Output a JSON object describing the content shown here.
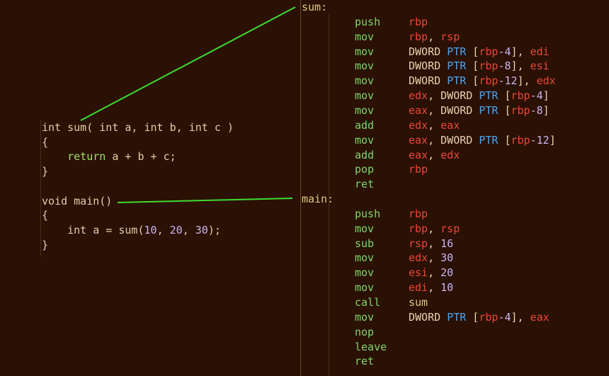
{
  "c_source": {
    "lines": [
      {
        "tokens": [
          {
            "t": "int sum( int a, int b, int c )",
            "c": "kw"
          }
        ]
      },
      {
        "tokens": [
          {
            "t": "{",
            "c": "plain"
          }
        ]
      },
      {
        "tokens": [
          {
            "t": "    ",
            "c": "plain"
          },
          {
            "t": "return",
            "c": "ret"
          },
          {
            "t": " a + b + c;",
            "c": "plain"
          }
        ]
      },
      {
        "tokens": [
          {
            "t": "}",
            "c": "plain"
          }
        ]
      },
      {
        "tokens": []
      },
      {
        "tokens": [
          {
            "t": "void main()",
            "c": "kw"
          }
        ]
      },
      {
        "tokens": [
          {
            "t": "{",
            "c": "plain"
          }
        ]
      },
      {
        "tokens": [
          {
            "t": "    int a = sum(",
            "c": "plain"
          },
          {
            "t": "10",
            "c": "num"
          },
          {
            "t": ", ",
            "c": "plain"
          },
          {
            "t": "20",
            "c": "num"
          },
          {
            "t": ", ",
            "c": "plain"
          },
          {
            "t": "30",
            "c": "num"
          },
          {
            "t": ");",
            "c": "plain"
          }
        ]
      },
      {
        "tokens": [
          {
            "t": "}",
            "c": "plain"
          }
        ]
      }
    ]
  },
  "asm": {
    "functions": [
      {
        "label": "sum:",
        "instructions": [
          {
            "mn": "push",
            "ops": [
              {
                "t": "rbp",
                "c": "reg"
              }
            ]
          },
          {
            "mn": "mov",
            "ops": [
              {
                "t": "rbp",
                "c": "reg"
              },
              {
                "t": ", ",
                "c": "sym"
              },
              {
                "t": "rsp",
                "c": "reg"
              }
            ]
          },
          {
            "mn": "mov",
            "ops": [
              {
                "t": "DWORD ",
                "c": "dw"
              },
              {
                "t": "PTR",
                "c": "ptr"
              },
              {
                "t": " [",
                "c": "sym"
              },
              {
                "t": "rbp",
                "c": "reg"
              },
              {
                "t": "-4",
                "c": "num"
              },
              {
                "t": "], ",
                "c": "sym"
              },
              {
                "t": "edi",
                "c": "reg"
              }
            ]
          },
          {
            "mn": "mov",
            "ops": [
              {
                "t": "DWORD ",
                "c": "dw"
              },
              {
                "t": "PTR",
                "c": "ptr"
              },
              {
                "t": " [",
                "c": "sym"
              },
              {
                "t": "rbp",
                "c": "reg"
              },
              {
                "t": "-8",
                "c": "num"
              },
              {
                "t": "], ",
                "c": "sym"
              },
              {
                "t": "esi",
                "c": "reg"
              }
            ]
          },
          {
            "mn": "mov",
            "ops": [
              {
                "t": "DWORD ",
                "c": "dw"
              },
              {
                "t": "PTR",
                "c": "ptr"
              },
              {
                "t": " [",
                "c": "sym"
              },
              {
                "t": "rbp",
                "c": "reg"
              },
              {
                "t": "-12",
                "c": "num"
              },
              {
                "t": "], ",
                "c": "sym"
              },
              {
                "t": "edx",
                "c": "reg"
              }
            ]
          },
          {
            "mn": "mov",
            "ops": [
              {
                "t": "edx",
                "c": "reg"
              },
              {
                "t": ", DWORD ",
                "c": "dw"
              },
              {
                "t": "PTR",
                "c": "ptr"
              },
              {
                "t": " [",
                "c": "sym"
              },
              {
                "t": "rbp",
                "c": "reg"
              },
              {
                "t": "-4",
                "c": "num"
              },
              {
                "t": "]",
                "c": "sym"
              }
            ]
          },
          {
            "mn": "mov",
            "ops": [
              {
                "t": "eax",
                "c": "reg"
              },
              {
                "t": ", DWORD ",
                "c": "dw"
              },
              {
                "t": "PTR",
                "c": "ptr"
              },
              {
                "t": " [",
                "c": "sym"
              },
              {
                "t": "rbp",
                "c": "reg"
              },
              {
                "t": "-8",
                "c": "num"
              },
              {
                "t": "]",
                "c": "sym"
              }
            ]
          },
          {
            "mn": "add",
            "ops": [
              {
                "t": "edx",
                "c": "reg"
              },
              {
                "t": ", ",
                "c": "sym"
              },
              {
                "t": "eax",
                "c": "reg"
              }
            ]
          },
          {
            "mn": "mov",
            "ops": [
              {
                "t": "eax",
                "c": "reg"
              },
              {
                "t": ", DWORD ",
                "c": "dw"
              },
              {
                "t": "PTR",
                "c": "ptr"
              },
              {
                "t": " [",
                "c": "sym"
              },
              {
                "t": "rbp",
                "c": "reg"
              },
              {
                "t": "-12",
                "c": "num"
              },
              {
                "t": "]",
                "c": "sym"
              }
            ]
          },
          {
            "mn": "add",
            "ops": [
              {
                "t": "eax",
                "c": "reg"
              },
              {
                "t": ", ",
                "c": "sym"
              },
              {
                "t": "edx",
                "c": "reg"
              }
            ]
          },
          {
            "mn": "pop",
            "ops": [
              {
                "t": "rbp",
                "c": "reg"
              }
            ]
          },
          {
            "mn": "ret",
            "ops": []
          }
        ]
      },
      {
        "label": "main:",
        "instructions": [
          {
            "mn": "push",
            "ops": [
              {
                "t": "rbp",
                "c": "reg"
              }
            ]
          },
          {
            "mn": "mov",
            "ops": [
              {
                "t": "rbp",
                "c": "reg"
              },
              {
                "t": ", ",
                "c": "sym"
              },
              {
                "t": "rsp",
                "c": "reg"
              }
            ]
          },
          {
            "mn": "sub",
            "ops": [
              {
                "t": "rsp",
                "c": "reg"
              },
              {
                "t": ", ",
                "c": "sym"
              },
              {
                "t": "16",
                "c": "num"
              }
            ]
          },
          {
            "mn": "mov",
            "ops": [
              {
                "t": "edx",
                "c": "reg"
              },
              {
                "t": ", ",
                "c": "sym"
              },
              {
                "t": "30",
                "c": "num"
              }
            ]
          },
          {
            "mn": "mov",
            "ops": [
              {
                "t": "esi",
                "c": "reg"
              },
              {
                "t": ", ",
                "c": "sym"
              },
              {
                "t": "20",
                "c": "num"
              }
            ]
          },
          {
            "mn": "mov",
            "ops": [
              {
                "t": "edi",
                "c": "reg"
              },
              {
                "t": ", ",
                "c": "sym"
              },
              {
                "t": "10",
                "c": "num"
              }
            ]
          },
          {
            "mn": "call",
            "ops": [
              {
                "t": "sum",
                "c": "label"
              }
            ]
          },
          {
            "mn": "mov",
            "ops": [
              {
                "t": "DWORD ",
                "c": "dw"
              },
              {
                "t": "PTR",
                "c": "ptr"
              },
              {
                "t": " [",
                "c": "sym"
              },
              {
                "t": "rbp",
                "c": "reg"
              },
              {
                "t": "-4",
                "c": "num"
              },
              {
                "t": "], ",
                "c": "sym"
              },
              {
                "t": "eax",
                "c": "reg"
              }
            ]
          },
          {
            "mn": "nop",
            "ops": []
          },
          {
            "mn": "leave",
            "ops": []
          },
          {
            "mn": "ret",
            "ops": []
          }
        ]
      }
    ]
  },
  "colors": {
    "background": "#2b1004",
    "connector": "#3ddc2e",
    "register": "#e8483a",
    "ptr_keyword": "#4ea4ea",
    "mnemonic": "#7fd66a",
    "number": "#c9b6f0",
    "label": "#e2c886",
    "code_text": "#e0cfa8"
  },
  "connectors": [
    {
      "from": "c-source line: int sum( int a, int b, int c )",
      "to": "asm label: sum:"
    },
    {
      "from": "c-source line: void main()",
      "to": "asm label: main:"
    }
  ]
}
